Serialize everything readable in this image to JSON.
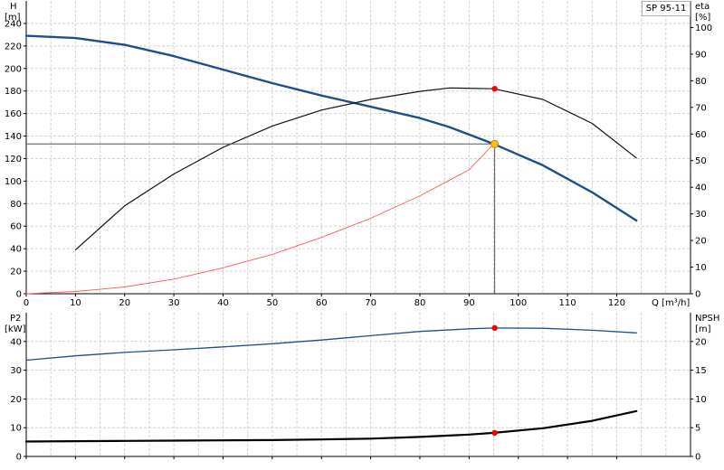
{
  "chart_data": [
    {
      "type": "line",
      "name": "head-efficiency",
      "x_label_text": "Q [m³/h]",
      "xlim": [
        0,
        135
      ],
      "x_ticks": [
        0,
        10,
        20,
        30,
        40,
        50,
        60,
        70,
        80,
        90,
        100,
        110,
        120
      ],
      "left_axis": {
        "label_line1": "H",
        "label_line2": "[m]",
        "ylim": [
          0,
          260
        ],
        "ticks": [
          0,
          20,
          40,
          60,
          80,
          100,
          120,
          140,
          160,
          180,
          200,
          220,
          240
        ]
      },
      "right_axis": {
        "label_line1": "eta",
        "label_line2": "[%]",
        "ylim": [
          0,
          110
        ],
        "ticks": [
          0,
          10,
          20,
          30,
          40,
          50,
          60,
          70,
          80,
          90,
          100
        ]
      },
      "legend_text": "SP 95-11",
      "series": [
        {
          "key": "H",
          "axis": "left",
          "color": "#1f4e8c",
          "width": 2.4,
          "x": [
            0,
            10,
            20,
            30,
            40,
            50,
            60,
            70,
            80,
            86,
            95,
            105,
            115,
            124
          ],
          "y": [
            229,
            227,
            221,
            211,
            199,
            187,
            176,
            166,
            156,
            148,
            133,
            114,
            90,
            65
          ]
        },
        {
          "key": "eta",
          "axis": "right",
          "color": "#111111",
          "width": 1.2,
          "x": [
            10,
            20,
            30,
            40,
            50,
            60,
            70,
            80,
            86,
            95,
            105,
            115,
            124
          ],
          "y": [
            16.5,
            33,
            45,
            55,
            63,
            69,
            73,
            76,
            77.3,
            77,
            73,
            64,
            51
          ]
        },
        {
          "key": "system",
          "axis": "left",
          "color": "#ff5a5a",
          "width": 0.9,
          "x": [
            0,
            10,
            20,
            30,
            40,
            50,
            60,
            70,
            80,
            90,
            95
          ],
          "y": [
            0,
            2,
            6,
            13,
            23,
            35,
            50,
            67,
            87,
            110,
            133
          ]
        }
      ],
      "operating_point": {
        "Q": 95.2,
        "H": 133,
        "eta": 77
      },
      "marker_colors": {
        "duty": "#ffc000",
        "duty_edge": "#d08000",
        "point": "#ff0000"
      }
    },
    {
      "type": "line",
      "name": "power-npsh",
      "xlim": [
        0,
        135
      ],
      "x_ticks": [
        0,
        10,
        20,
        30,
        40,
        50,
        60,
        70,
        80,
        90,
        100,
        110,
        120
      ],
      "left_axis": {
        "label_line1": "P2",
        "label_line2": "[kW]",
        "ylim": [
          0,
          50
        ],
        "ticks": [
          0,
          10,
          20,
          30,
          40
        ]
      },
      "right_axis": {
        "label_line1": "NPSH",
        "label_line2": "[m]",
        "ylim": [
          0,
          25
        ],
        "ticks": [
          0,
          5,
          10,
          15,
          20
        ]
      },
      "series": [
        {
          "key": "P2",
          "axis": "left",
          "color": "#1f4e8c",
          "width": 1.3,
          "x": [
            0,
            10,
            20,
            30,
            40,
            50,
            60,
            70,
            80,
            90,
            95,
            105,
            115,
            124
          ],
          "y": [
            33.5,
            35,
            36.2,
            37.1,
            38.1,
            39.2,
            40.5,
            42,
            43.5,
            44.4,
            44.7,
            44.6,
            43.9,
            43
          ]
        },
        {
          "key": "NPSH",
          "axis": "right",
          "color": "#000000",
          "width": 2.2,
          "x": [
            0,
            10,
            20,
            30,
            40,
            50,
            60,
            70,
            80,
            90,
            95,
            105,
            115,
            124
          ],
          "y": [
            2.6,
            2.65,
            2.7,
            2.75,
            2.8,
            2.85,
            2.95,
            3.1,
            3.4,
            3.8,
            4.1,
            4.9,
            6.2,
            7.9
          ]
        }
      ],
      "operating_point": {
        "Q": 95.2,
        "P2": 44.7,
        "NPSH": 4.1
      },
      "marker_colors": {
        "point": "#ff0000"
      }
    }
  ]
}
